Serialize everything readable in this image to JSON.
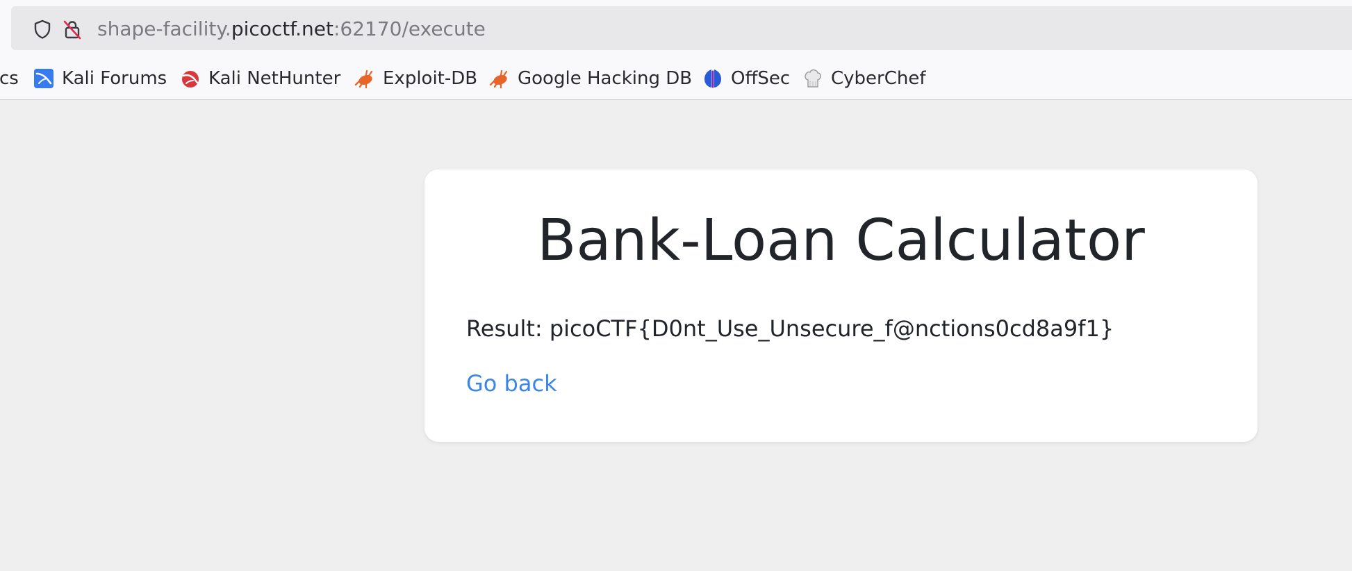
{
  "browser": {
    "url": {
      "prefix": "shape-facility.",
      "host": "picoctf.net",
      "suffix": ":62170/execute"
    },
    "bookmarks": [
      {
        "label": "cs",
        "icon": "bookmark-partial"
      },
      {
        "label": "Kali Forums",
        "icon": "kali-forums-icon"
      },
      {
        "label": "Kali NetHunter",
        "icon": "kali-nethunter-icon"
      },
      {
        "label": "Exploit-DB",
        "icon": "exploit-db-icon"
      },
      {
        "label": "Google Hacking DB",
        "icon": "ghdb-icon"
      },
      {
        "label": "OffSec",
        "icon": "offsec-icon"
      },
      {
        "label": "CyberChef",
        "icon": "cyberchef-icon"
      }
    ]
  },
  "page": {
    "title": "Bank-Loan Calculator",
    "result_label": "Result:",
    "result_value": "picoCTF{D0nt_Use_Unsecure_f@nctions0cd8a9f1}",
    "back_link": "Go back"
  },
  "colors": {
    "link": "#3a86e8",
    "text": "#212529",
    "background": "#efefef"
  }
}
